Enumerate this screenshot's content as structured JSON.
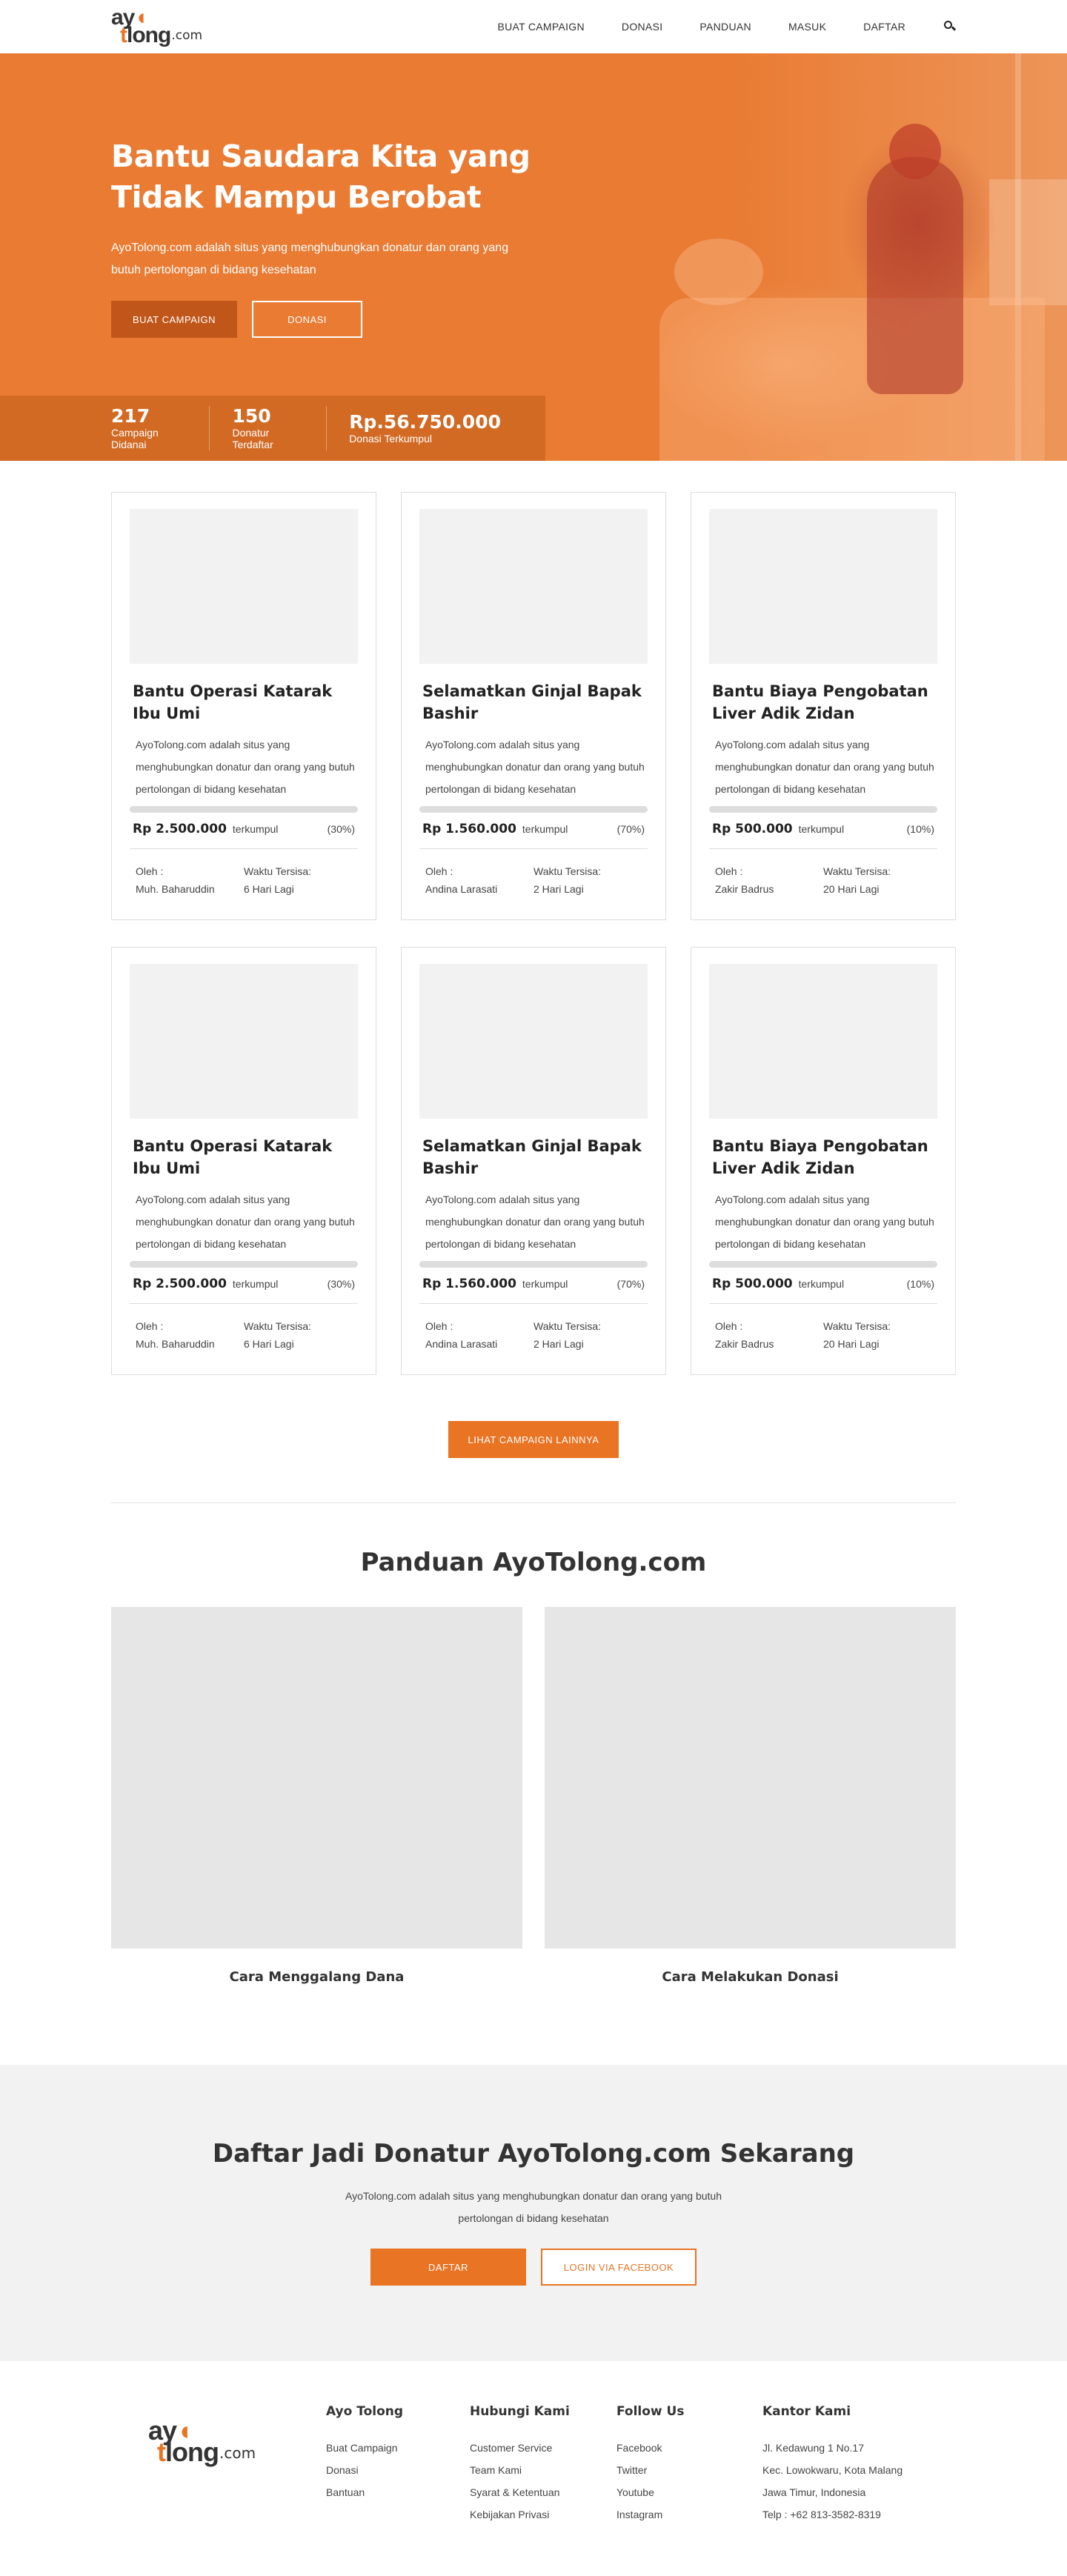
{
  "brand": {
    "logo_top": "ay",
    "logo_bottom": "long",
    "logo_suffix": ".com",
    "accent": "#e87424",
    "accent_dark": "#c0561a"
  },
  "nav": {
    "items": [
      "BUAT CAMPAIGN",
      "DONASI",
      "PANDUAN",
      "MASUK",
      "DAFTAR"
    ],
    "search_icon": "search-icon"
  },
  "hero": {
    "title_line1": "Bantu Saudara Kita yang",
    "title_line2": "Tidak Mampu Berobat",
    "desc": "AyoTolong.com adalah situs yang menghubungkan donatur dan orang yang butuh pertolongan di bidang kesehatan",
    "btn_primary": "BUAT CAMPAIGN",
    "btn_secondary": "DONASI",
    "stats": [
      {
        "value": "217",
        "label": "Campaign Didanai"
      },
      {
        "value": "150",
        "label": "Donatur Terdaftar"
      },
      {
        "value": "Rp.56.750.000",
        "label": "Donasi Terkumpul"
      }
    ]
  },
  "campaigns": [
    {
      "title": "Bantu Operasi Katarak Ibu Umi",
      "desc": "AyoTolong.com adalah situs yang menghubungkan donatur dan orang yang butuh pertolongan di bidang kesehatan",
      "amount": "Rp 2.500.000",
      "collected_label": "terkumpul",
      "percent_text": "(30%)",
      "progress": 0.3,
      "by_label": "Oleh :",
      "by": "Muh. Baharuddin",
      "time_label": "Waktu Tersisa:",
      "time": "6 Hari Lagi"
    },
    {
      "title": "Selamatkan Ginjal Bapak Bashir",
      "desc": "AyoTolong.com adalah situs yang menghubungkan donatur dan orang yang butuh pertolongan di bidang kesehatan",
      "amount": "Rp 1.560.000",
      "collected_label": "terkumpul",
      "percent_text": "(70%)",
      "progress": 0.7,
      "by_label": "Oleh :",
      "by": "Andina Larasati",
      "time_label": "Waktu Tersisa:",
      "time": "2 Hari Lagi"
    },
    {
      "title": "Bantu Biaya Pengobatan Liver Adik Zidan",
      "desc": "AyoTolong.com adalah situs yang menghubungkan donatur dan orang yang butuh pertolongan di bidang kesehatan",
      "amount": "Rp 500.000",
      "collected_label": "terkumpul",
      "percent_text": "(10%)",
      "progress": 0.1,
      "by_label": "Oleh :",
      "by": "Zakir Badrus",
      "time_label": "Waktu Tersisa:",
      "time": "20 Hari Lagi"
    },
    {
      "title": "Bantu Operasi Katarak Ibu Umi",
      "desc": "AyoTolong.com adalah situs yang menghubungkan donatur dan orang yang butuh pertolongan di bidang kesehatan",
      "amount": "Rp 2.500.000",
      "collected_label": "terkumpul",
      "percent_text": "(30%)",
      "progress": 0.3,
      "by_label": "Oleh :",
      "by": "Muh. Baharuddin",
      "time_label": "Waktu Tersisa:",
      "time": "6 Hari Lagi"
    },
    {
      "title": "Selamatkan Ginjal Bapak Bashir",
      "desc": "AyoTolong.com adalah situs yang menghubungkan donatur dan orang yang butuh pertolongan di bidang kesehatan",
      "amount": "Rp 1.560.000",
      "collected_label": "terkumpul",
      "percent_text": "(70%)",
      "progress": 0.7,
      "by_label": "Oleh :",
      "by": "Andina Larasati",
      "time_label": "Waktu Tersisa:",
      "time": "2 Hari Lagi"
    },
    {
      "title": "Bantu Biaya Pengobatan Liver Adik Zidan",
      "desc": "AyoTolong.com adalah situs yang menghubungkan donatur dan orang yang butuh pertolongan di bidang kesehatan",
      "amount": "Rp 500.000",
      "collected_label": "terkumpul",
      "percent_text": "(10%)",
      "progress": 0.1,
      "by_label": "Oleh :",
      "by": "Zakir Badrus",
      "time_label": "Waktu Tersisa:",
      "time": "20 Hari Lagi"
    }
  ],
  "more_button": "LIHAT CAMPAIGN LAINNYA",
  "panduan": {
    "title": "Panduan AyoTolong.com",
    "items": [
      {
        "caption": "Cara Menggalang Dana"
      },
      {
        "caption": "Cara Melakukan Donasi"
      }
    ]
  },
  "cta": {
    "title": "Daftar Jadi Donatur AyoTolong.com Sekarang",
    "desc": "AyoTolong.com adalah situs yang menghubungkan donatur dan orang yang butuh pertolongan di bidang kesehatan",
    "btn_primary": "DAFTAR",
    "btn_secondary": "LOGIN VIA FACEBOOK"
  },
  "footer": {
    "columns": [
      {
        "title": "Ayo Tolong",
        "links": [
          "Buat Campaign",
          "Donasi",
          "Bantuan"
        ]
      },
      {
        "title": "Hubungi Kami",
        "links": [
          "Customer Service",
          "Team Kami",
          "Syarat & Ketentuan",
          "Kebijakan Privasi"
        ]
      },
      {
        "title": "Follow Us",
        "links": [
          "Facebook",
          "Twitter",
          "Youtube",
          "Instagram"
        ]
      },
      {
        "title": "Kantor Kami",
        "lines": [
          "Jl. Kedawung 1 No.17",
          "Kec. Lowokwaru, Kota Malang",
          "Jawa Timur, Indonesia",
          "Telp : +62 813-3582-8319"
        ]
      }
    ]
  }
}
